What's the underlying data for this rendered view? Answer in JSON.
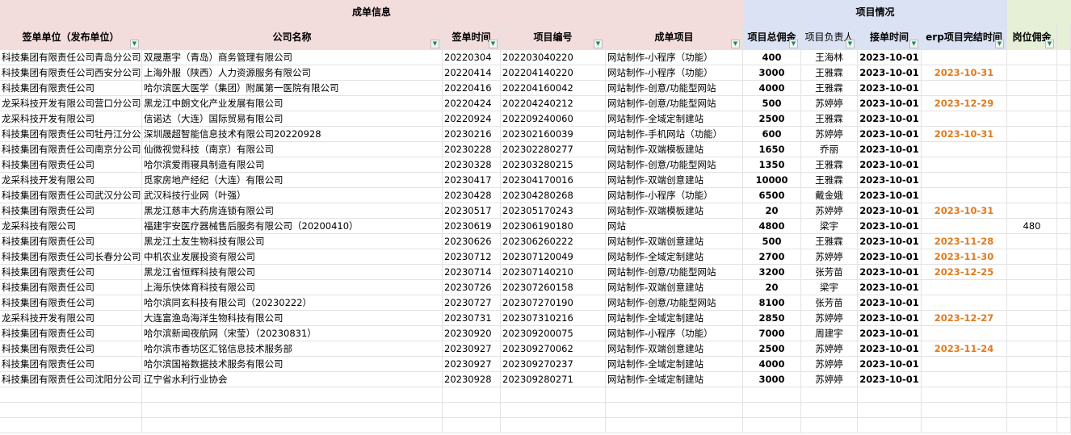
{
  "groups": {
    "deal_info": "成单信息",
    "project_info": "项目情况"
  },
  "columns": [
    {
      "key": "signer",
      "label": "签单单位（发布单位）"
    },
    {
      "key": "company",
      "label": "公司名称"
    },
    {
      "key": "sign_date",
      "label": "签单时间"
    },
    {
      "key": "project_no",
      "label": "项目编号"
    },
    {
      "key": "deal_item",
      "label": "成单项目"
    },
    {
      "key": "commission",
      "label": "项目总佣金"
    },
    {
      "key": "owner",
      "label": "项目负责人"
    },
    {
      "key": "accept_date",
      "label": "接单时间"
    },
    {
      "key": "erp_done",
      "label": "erp项目完结时间"
    },
    {
      "key": "post_comm",
      "label": "岗位佣金"
    }
  ],
  "rows": [
    {
      "signer": "科技集团有限责任公司青岛分公司",
      "company": "双晟惠宇（青岛）商务管理有限公司",
      "sign_date": "20220304",
      "project_no": "202203040220",
      "deal_item": "网站制作-小程序（功能）",
      "commission": "400",
      "owner": "王海林",
      "accept_date": "2023-10-01",
      "erp_done": "",
      "post_comm": ""
    },
    {
      "signer": "科技集团有限责任公司西安分公司",
      "company": "上海外服（陕西）人力资源服务有限公司",
      "sign_date": "20220414",
      "project_no": "202204140220",
      "deal_item": "网站制作-小程序（功能）",
      "commission": "3000",
      "owner": "王雅霖",
      "accept_date": "2023-10-01",
      "erp_done": "2023-10-31",
      "post_comm": ""
    },
    {
      "signer": "科技集团有限责任公司",
      "company": "哈尔滨医大医学（集团）附属第一医院有限公司",
      "sign_date": "20220416",
      "project_no": "202204160042",
      "deal_item": "网站制作-创意/功能型网站",
      "commission": "4000",
      "owner": "王雅霖",
      "accept_date": "2023-10-01",
      "erp_done": "",
      "post_comm": ""
    },
    {
      "signer": "龙采科技开发有限公司营口分公司",
      "company": "黑龙江中朗文化产业发展有限公司",
      "sign_date": "20220424",
      "project_no": "202204240212",
      "deal_item": "网站制作-创意/功能型网站",
      "commission": "500",
      "owner": "苏婷婷",
      "accept_date": "2023-10-01",
      "erp_done": "2023-12-29",
      "post_comm": ""
    },
    {
      "signer": "龙采科技开发有限公司",
      "company": "信诺达（大连）国际贸易有限公司",
      "sign_date": "20220924",
      "project_no": "202209240060",
      "deal_item": "网站制作-全域定制建站",
      "commission": "2500",
      "owner": "王雅霖",
      "accept_date": "2023-10-01",
      "erp_done": "",
      "post_comm": ""
    },
    {
      "signer": "科技集团有限责任公司牡丹江分公司",
      "company": "深圳晟超智能信息技术有限公司20220928",
      "sign_date": "20230216",
      "project_no": "202302160039",
      "deal_item": "网站制作-手机网站（功能）",
      "commission": "600",
      "owner": "苏婷婷",
      "accept_date": "2023-10-01",
      "erp_done": "2023-10-31",
      "post_comm": ""
    },
    {
      "signer": "科技集团有限责任公司南京分公司",
      "company": "仙微视觉科技（南京）有限公司",
      "sign_date": "20230228",
      "project_no": "202302280277",
      "deal_item": "网站制作-双端模板建站",
      "commission": "1650",
      "owner": "乔丽",
      "accept_date": "2023-10-01",
      "erp_done": "",
      "post_comm": ""
    },
    {
      "signer": "科技集团有限责任公司",
      "company": "哈尔滨爱雨寝具制造有限公司",
      "sign_date": "20230328",
      "project_no": "202303280215",
      "deal_item": "网站制作-创意/功能型网站",
      "commission": "1350",
      "owner": "王雅霖",
      "accept_date": "2023-10-01",
      "erp_done": "",
      "post_comm": ""
    },
    {
      "signer": "龙采科技开发有限公司",
      "company": "觅家房地产经纪（大连）有限公司",
      "sign_date": "20230417",
      "project_no": "202304170016",
      "deal_item": "网站制作-双端创意建站",
      "commission": "10000",
      "owner": "王雅霖",
      "accept_date": "2023-10-01",
      "erp_done": "",
      "post_comm": ""
    },
    {
      "signer": "科技集团有限责任公司武汉分公司",
      "company": "武汉科技行业网（叶强）",
      "sign_date": "20230428",
      "project_no": "202304280268",
      "deal_item": "网站制作-小程序（功能）",
      "commission": "6500",
      "owner": "戴金娥",
      "accept_date": "2023-10-01",
      "erp_done": "",
      "post_comm": ""
    },
    {
      "signer": "科技集团有限责任公司",
      "company": "黑龙江慈丰大药房连锁有限公司",
      "sign_date": "20230517",
      "project_no": "202305170243",
      "deal_item": "网站制作-双端模板建站",
      "commission": "20",
      "owner": "苏婷婷",
      "accept_date": "2023-10-01",
      "erp_done": "2023-10-31",
      "post_comm": ""
    },
    {
      "signer": "龙采科技有限公司",
      "company": "福建宇安医疗器械售后服务有限公司（20200410）",
      "sign_date": "20230619",
      "project_no": "202306190180",
      "deal_item": "网站",
      "commission": "4800",
      "owner": "梁宇",
      "accept_date": "2023-10-01",
      "erp_done": "",
      "post_comm": "480"
    },
    {
      "signer": "科技集团有限责任公司",
      "company": "黑龙江土友生物科技有限公司",
      "sign_date": "20230626",
      "project_no": "202306260222",
      "deal_item": "网站制作-双端创意建站",
      "commission": "500",
      "owner": "王雅霖",
      "accept_date": "2023-10-01",
      "erp_done": "2023-11-28",
      "post_comm": ""
    },
    {
      "signer": "科技集团有限责任公司长春分公司",
      "company": "中机农业发展投资有限公司",
      "sign_date": "20230712",
      "project_no": "202307120049",
      "deal_item": "网站制作-全域定制建站",
      "commission": "2700",
      "owner": "苏婷婷",
      "accept_date": "2023-10-01",
      "erp_done": "2023-11-30",
      "post_comm": ""
    },
    {
      "signer": "科技集团有限责任公司",
      "company": "黑龙江省恒辉科技有限公司",
      "sign_date": "20230714",
      "project_no": "202307140210",
      "deal_item": "网站制作-创意/功能型网站",
      "commission": "3200",
      "owner": "张芳苗",
      "accept_date": "2023-10-01",
      "erp_done": "2023-12-25",
      "post_comm": ""
    },
    {
      "signer": "科技集团有限责任公司",
      "company": "上海乐快体育科技有限公司",
      "sign_date": "20230726",
      "project_no": "202307260158",
      "deal_item": "网站制作-双端创意建站",
      "commission": "20",
      "owner": "梁宇",
      "accept_date": "2023-10-01",
      "erp_done": "",
      "post_comm": ""
    },
    {
      "signer": "科技集团有限责任公司",
      "company": "哈尔滨同玄科技有限公司（20230222）",
      "sign_date": "20230727",
      "project_no": "202307270190",
      "deal_item": "网站制作-创意/功能型网站",
      "commission": "8100",
      "owner": "张芳苗",
      "accept_date": "2023-10-01",
      "erp_done": "",
      "post_comm": ""
    },
    {
      "signer": "龙采科技开发有限公司",
      "company": "大连富渔岛海洋生物科技有限公司",
      "sign_date": "20230731",
      "project_no": "202307310216",
      "deal_item": "网站制作-全域定制建站",
      "commission": "2850",
      "owner": "苏婷婷",
      "accept_date": "2023-10-01",
      "erp_done": "2023-12-27",
      "post_comm": ""
    },
    {
      "signer": "科技集团有限责任公司",
      "company": "哈尔滨新闻夜航网（宋莹）（20230831）",
      "sign_date": "20230920",
      "project_no": "202309200075",
      "deal_item": "网站制作-小程序（功能）",
      "commission": "7000",
      "owner": "周建宇",
      "accept_date": "2023-10-01",
      "erp_done": "",
      "post_comm": ""
    },
    {
      "signer": "科技集团有限责任公司",
      "company": "哈尔滨市香坊区汇铭信息技术服务部",
      "sign_date": "20230927",
      "project_no": "202309270062",
      "deal_item": "网站制作-双端创意建站",
      "commission": "2500",
      "owner": "苏婷婷",
      "accept_date": "2023-10-01",
      "erp_done": "2023-11-24",
      "post_comm": ""
    },
    {
      "signer": "科技集团有限责任公司",
      "company": "哈尔滨国裕数据技术服务有限公司",
      "sign_date": "20230927",
      "project_no": "202309270237",
      "deal_item": "网站制作-全域定制建站",
      "commission": "4000",
      "owner": "苏婷婷",
      "accept_date": "2023-10-01",
      "erp_done": "",
      "post_comm": ""
    },
    {
      "signer": "科技集团有限责任公司沈阳分公司",
      "company": "辽宁省水利行业协会",
      "sign_date": "20230928",
      "project_no": "202309280271",
      "deal_item": "网站制作-全域定制建站",
      "commission": "3000",
      "owner": "苏婷婷",
      "accept_date": "2023-10-01",
      "erp_done": "",
      "post_comm": ""
    }
  ],
  "colors": {
    "deal_header_bg": "#f3dcdc",
    "project_header_bg": "#dbe2f3",
    "post_header_bg": "#e6f0d6",
    "erp_date_color": "#e07a1e"
  }
}
